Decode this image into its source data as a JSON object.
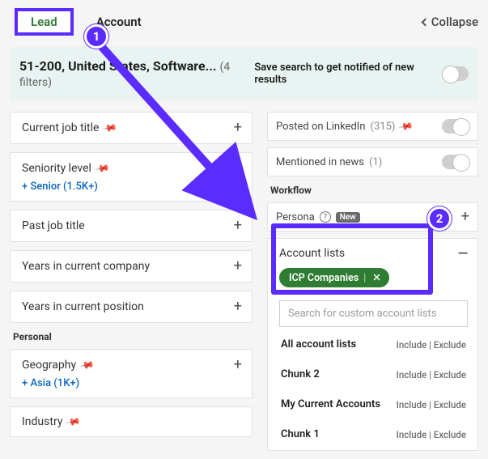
{
  "tabs": {
    "lead": "Lead",
    "account": "Account"
  },
  "collapse": "Collapse",
  "summary": {
    "text": "51-200, United States, Software...",
    "filters": "(4 filters)",
    "save": "Save search to get notified of new results"
  },
  "left": {
    "current_job": "Current job title",
    "seniority": "Seniority level",
    "seniority_chip": "+ Senior (1.5K+)",
    "past_job": "Past job title",
    "years_company": "Years in current company",
    "years_position": "Years in current position",
    "personal": "Personal",
    "geography": "Geography",
    "geo_chip": "+ Asia (1K+)",
    "industry": "Industry"
  },
  "right": {
    "posted": "Posted on LinkedIn",
    "posted_count": "(315)",
    "mentioned": "Mentioned in news",
    "mentioned_count": "(1)",
    "workflow": "Workflow",
    "persona": "Persona",
    "new": "New",
    "account_lists": "Account lists",
    "pill": "ICP Companies",
    "search_placeholder": "Search for custom account lists",
    "lists": [
      {
        "name": "All account lists"
      },
      {
        "name": "Chunk 2"
      },
      {
        "name": "My Current Accounts"
      },
      {
        "name": "Chunk 1"
      }
    ],
    "include": "Include",
    "exclude": "Exclude"
  },
  "ann": {
    "one": "1",
    "two": "2"
  }
}
